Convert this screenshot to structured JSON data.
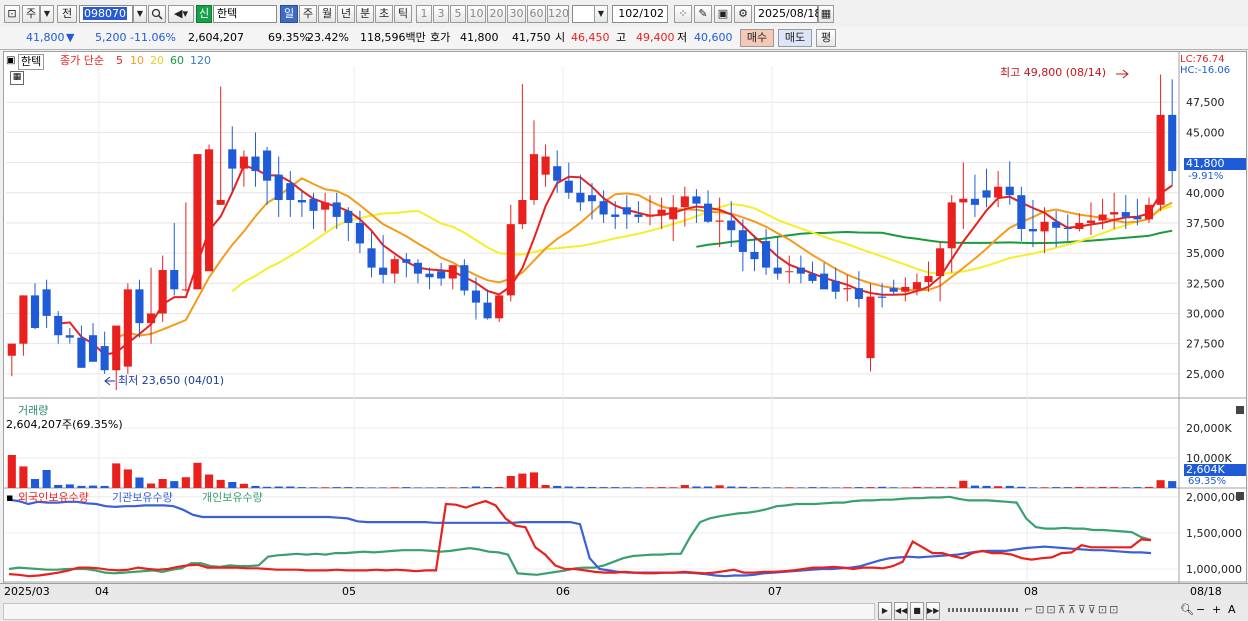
{
  "toolbar": {
    "market_type": "주",
    "prev_label": "전",
    "code": "098070",
    "new_badge": "신",
    "stock_name": "한텍",
    "periods": [
      "일",
      "주",
      "월",
      "년",
      "분",
      "초",
      "틱"
    ],
    "active_period": "일",
    "intervals": [
      "1",
      "3",
      "5",
      "10",
      "20",
      "30",
      "60",
      "120"
    ],
    "count": "102",
    "count_total": "/102",
    "date": "2025/08/18"
  },
  "quote": {
    "price": "41,800",
    "change_arrow": "▼",
    "change": "5,200",
    "change_pct": "-11.06%",
    "volume": "2,604,207",
    "vol_ratio": "69.35%",
    "turnover": "23.42%",
    "amount": "118,596백만",
    "hoga_label": "호가",
    "ask": "41,800",
    "bid": "41,750",
    "open_label": "시",
    "open": "46,450",
    "high_label": "고",
    "high": "49,400",
    "low_label": "저",
    "low": "40,600",
    "buy_label": "매수",
    "sell_label": "매도",
    "eval_label": "평"
  },
  "price_panel": {
    "name_tag": "한텍",
    "ma_label": "종가 단순",
    "ma_periods": [
      "5",
      "10",
      "20",
      "60",
      "120"
    ],
    "lc": "LC:76.74",
    "hc": "HC:-16.06",
    "high_note": "최고 49,800 (08/14)",
    "low_note": "최저 23,650 (04/01)",
    "cur_price": "41,800",
    "cur_pct": "-9.91%",
    "y_ticks": [
      "47,500",
      "45,000",
      "42,500",
      "40,000",
      "37,500",
      "35,000",
      "32,500",
      "30,000",
      "27,500",
      "25,000"
    ]
  },
  "volume_panel": {
    "title": "거래량",
    "current": "2,604,207주(69.35%)",
    "y_ticks": [
      "20,000K",
      "10,000K"
    ],
    "cur_value": "2,604K",
    "cur_pct": "69.35%"
  },
  "holding_panel": {
    "legend": [
      "외국인보유수량",
      "기관보유수량",
      "개인보유수량"
    ],
    "y_ticks": [
      "2,000,000",
      "1,500,000",
      "1,000,000"
    ]
  },
  "x_axis": {
    "labels": [
      "2025/03",
      "04",
      "05",
      "06",
      "07",
      "08"
    ],
    "end_label": "08/18"
  },
  "colors": {
    "up": "#e8211f",
    "down": "#1f5bd6",
    "ma5": "#e8211f",
    "ma10": "#f59b1c",
    "ma20": "#f5ee2a",
    "ma60": "#1a9a3a",
    "foreign": "#e8211f",
    "institution": "#3a60d8",
    "individual": "#3aa070"
  },
  "chart_data": {
    "type": "candlestick",
    "title": "한텍",
    "open": [
      26500,
      27500,
      31500,
      32000,
      29800,
      28200,
      28000,
      28200,
      27300,
      25300,
      25600,
      32000,
      29200,
      30000,
      33600,
      32000,
      32000,
      33500,
      39000,
      43600,
      42000,
      43000,
      43500,
      41500,
      40800,
      39400,
      39500,
      38600,
      39200,
      38500,
      37500,
      35400,
      33800,
      33300,
      34500,
      34200,
      33300,
      33500,
      32900,
      34000,
      31900,
      30900,
      29600,
      31500,
      37400,
      39400,
      41500,
      42200,
      41000,
      40000,
      39800,
      39300,
      38200,
      38800,
      38200,
      38100,
      38100,
      37800,
      38800,
      39700,
      39100,
      37600,
      37700,
      36900,
      35100,
      36000,
      33800,
      33500,
      33800,
      33300,
      33300,
      32700,
      32000,
      32100,
      26300,
      31400,
      32100,
      31800,
      32000,
      32600,
      33100,
      35400,
      39200,
      39500,
      40200,
      39600,
      40500,
      39800,
      37000,
      36800,
      37600,
      37100,
      37000,
      37500,
      37700,
      38200,
      38400,
      38000,
      37800,
      39000,
      46450
    ],
    "high": [
      27500,
      31500,
      32500,
      32800,
      30200,
      28800,
      29000,
      29200,
      28500,
      27200,
      32500,
      32800,
      33800,
      34800,
      37500,
      39200,
      43200,
      44000,
      48800,
      45500,
      43500,
      45000,
      43800,
      43000,
      41800,
      40200,
      40000,
      40000,
      40000,
      38800,
      38500,
      36800,
      36500,
      34800,
      35000,
      34500,
      33800,
      34200,
      34000,
      34500,
      33000,
      32000,
      31000,
      39000,
      49000,
      46000,
      44000,
      43500,
      42500,
      41500,
      40800,
      40200,
      39300,
      39800,
      39300,
      39800,
      39600,
      39800,
      40500,
      40300,
      40200,
      39600,
      39300,
      37800,
      36500,
      37000,
      36300,
      34800,
      34800,
      34300,
      34200,
      33800,
      33200,
      33500,
      32500,
      32500,
      32800,
      33000,
      33300,
      34300,
      36000,
      39800,
      42500,
      41500,
      42000,
      41800,
      42600,
      40500,
      39400,
      38800,
      38500,
      38200,
      38300,
      39200,
      39500,
      40000,
      39800,
      39500,
      39600,
      49800,
      49400
    ],
    "low": [
      24800,
      26500,
      28700,
      28800,
      27500,
      27500,
      25500,
      26000,
      25000,
      23650,
      25000,
      28000,
      27500,
      29300,
      31500,
      31800,
      32000,
      34500,
      39000,
      40000,
      40500,
      40500,
      39000,
      38000,
      38000,
      38000,
      37000,
      36800,
      37000,
      36000,
      35000,
      33000,
      32500,
      32500,
      33000,
      32500,
      32000,
      32300,
      32000,
      31500,
      29500,
      29500,
      29300,
      31000,
      37000,
      39000,
      40500,
      40000,
      39500,
      38500,
      37800,
      37500,
      37000,
      37000,
      37500,
      37300,
      37000,
      36000,
      37200,
      37500,
      37500,
      35500,
      35500,
      33500,
      33500,
      33200,
      32800,
      32500,
      32500,
      32500,
      32000,
      31200,
      31000,
      30500,
      25200,
      30500,
      31500,
      31000,
      31500,
      31800,
      31000,
      33400,
      37000,
      38000,
      38800,
      38800,
      39000,
      36000,
      35500,
      35000,
      35500,
      36000,
      36800,
      36500,
      37000,
      37000,
      37000,
      37300,
      37500,
      38500,
      40600
    ],
    "close": [
      27500,
      31500,
      28800,
      29800,
      28200,
      28000,
      25500,
      26000,
      25300,
      29000,
      32000,
      29200,
      30000,
      33600,
      32000,
      32000,
      43200,
      43600,
      39400,
      42000,
      43000,
      41800,
      41000,
      39400,
      39400,
      39200,
      38500,
      39200,
      38000,
      37500,
      35800,
      33800,
      33200,
      34500,
      34200,
      33300,
      33000,
      32900,
      34000,
      31900,
      30900,
      29600,
      31500,
      37400,
      39400,
      43200,
      43000,
      41000,
      40000,
      39200,
      39300,
      38200,
      38000,
      38200,
      38000,
      38100,
      38600,
      38800,
      39700,
      39100,
      37600,
      37700,
      36900,
      35100,
      34500,
      33800,
      33300,
      33500,
      33300,
      32700,
      32000,
      31800,
      32100,
      31200,
      31400,
      31300,
      31800,
      32200,
      32600,
      33100,
      35400,
      39200,
      39500,
      39000,
      39600,
      40500,
      39800,
      37000,
      36800,
      37600,
      37100,
      37000,
      37500,
      37700,
      38200,
      38400,
      38000,
      37800,
      39000,
      46450,
      41800
    ],
    "ylim": [
      23000,
      50500
    ],
    "volume_k": [
      11000,
      7200,
      3000,
      6000,
      1000,
      1200,
      700,
      800,
      700,
      8200,
      6200,
      3500,
      1500,
      3000,
      2300,
      3600,
      8400,
      4500,
      2700,
      2000,
      1400,
      700,
      400,
      500,
      500,
      300,
      250,
      250,
      300,
      300,
      250,
      200,
      200,
      250,
      300,
      200,
      200,
      250,
      200,
      300,
      500,
      350,
      350,
      4000,
      4800,
      5200,
      1000,
      700,
      500,
      400,
      350,
      300,
      300,
      250,
      250,
      250,
      300,
      250,
      1000,
      500,
      500,
      900,
      500,
      400,
      300,
      250,
      200,
      250,
      200,
      300,
      250,
      200,
      250,
      300,
      300,
      400,
      250,
      200,
      350,
      250,
      300,
      300,
      2400,
      800,
      700,
      600,
      700,
      400,
      250,
      250,
      300,
      300,
      350,
      250,
      350,
      300,
      250,
      300,
      350,
      2604,
      2300
    ],
    "volume_ylim": [
      0,
      28000
    ],
    "holdings": {
      "foreign": [
        930000,
        920000,
        900000,
        910000,
        930000,
        950000,
        980000,
        1020000,
        1020000,
        1010000,
        990000,
        980000,
        990000,
        1020000,
        1000000,
        990000,
        1000000,
        1030000,
        1050000,
        1060000,
        1020000,
        1020000,
        1020000,
        1020000,
        1010000,
        1010000,
        1000000,
        990000,
        990000,
        990000,
        980000,
        980000,
        980000,
        990000,
        980000,
        980000,
        980000,
        990000,
        980000,
        990000,
        980000,
        970000,
        980000,
        980000,
        1900000,
        1890000,
        1850000,
        1900000,
        1940000,
        1880000,
        1700000,
        1600000,
        1580000,
        1300000,
        1200000,
        1050000,
        1000000,
        1000000,
        980000,
        960000,
        950000,
        950000,
        960000,
        950000,
        940000,
        940000,
        950000,
        950000,
        960000,
        950000,
        940000,
        950000,
        970000,
        990000,
        950000,
        950000,
        960000,
        960000,
        970000,
        980000,
        1000000,
        1020000,
        1020000,
        1030000,
        1020000,
        1000000,
        1020000,
        1020000,
        1010000,
        1040000,
        1100000,
        1380000,
        1300000,
        1220000,
        1220000,
        1180000,
        1150000,
        1220000,
        1250000,
        1220000,
        1220000,
        1200000,
        1150000,
        1130000,
        1150000,
        1160000,
        1220000,
        1230000,
        1330000,
        1300000,
        1300000,
        1300000,
        1300000,
        1300000,
        1410000,
        1400000
      ],
      "institution": [
        1960000,
        1940000,
        1900000,
        1930000,
        1920000,
        1920000,
        1930000,
        1930000,
        1910000,
        1900000,
        1870000,
        1860000,
        1870000,
        1870000,
        1880000,
        1880000,
        1880000,
        1870000,
        1820000,
        1750000,
        1720000,
        1720000,
        1720000,
        1720000,
        1720000,
        1720000,
        1720000,
        1720000,
        1720000,
        1720000,
        1720000,
        1720000,
        1720000,
        1720000,
        1710000,
        1700000,
        1660000,
        1650000,
        1650000,
        1650000,
        1650000,
        1650000,
        1650000,
        1650000,
        1640000,
        1640000,
        1640000,
        1640000,
        1640000,
        1640000,
        1640000,
        1640000,
        1640000,
        1650000,
        1650000,
        1650000,
        1650000,
        1650000,
        1650000,
        1620000,
        1150000,
        1000000,
        980000,
        960000,
        950000,
        950000,
        950000,
        950000,
        950000,
        950000,
        950000,
        940000,
        930000,
        910000,
        900000,
        910000,
        910000,
        920000,
        940000,
        950000,
        960000,
        970000,
        980000,
        990000,
        1000000,
        1000000,
        1010000,
        1020000,
        1040000,
        1080000,
        1120000,
        1150000,
        1160000,
        1170000,
        1160000,
        1170000,
        1180000,
        1190000,
        1200000,
        1220000,
        1240000,
        1250000,
        1250000,
        1250000,
        1270000,
        1290000,
        1300000,
        1310000,
        1300000,
        1290000,
        1280000,
        1270000,
        1260000,
        1260000,
        1250000,
        1240000,
        1230000,
        1230000,
        1220000
      ],
      "individual": [
        1000000,
        1020000,
        1010000,
        1000000,
        990000,
        990000,
        1000000,
        1000000,
        1000000,
        980000,
        950000,
        940000,
        950000,
        960000,
        970000,
        980000,
        960000,
        990000,
        1010000,
        1080000,
        1080000,
        1040000,
        1030000,
        1050000,
        1040000,
        1040000,
        1050000,
        1170000,
        1190000,
        1200000,
        1210000,
        1200000,
        1210000,
        1200000,
        1220000,
        1220000,
        1230000,
        1240000,
        1230000,
        1240000,
        1250000,
        1260000,
        1260000,
        1260000,
        1250000,
        1240000,
        1250000,
        1270000,
        1290000,
        1270000,
        1240000,
        1230000,
        1200000,
        940000,
        930000,
        920000,
        940000,
        960000,
        980000,
        1010000,
        1020000,
        1020000,
        1050000,
        1100000,
        1150000,
        1180000,
        1190000,
        1200000,
        1200000,
        1210000,
        1210000,
        1450000,
        1650000,
        1700000,
        1730000,
        1750000,
        1770000,
        1780000,
        1800000,
        1830000,
        1870000,
        1880000,
        1900000,
        1900000,
        1900000,
        1910000,
        1920000,
        1920000,
        1940000,
        1950000,
        1950000,
        1960000,
        1960000,
        1970000,
        1980000,
        1980000,
        1990000,
        1990000,
        2000000,
        1970000,
        1950000,
        1950000,
        1950000,
        1940000,
        1930000,
        1920000,
        1700000,
        1580000,
        1560000,
        1560000,
        1570000,
        1560000,
        1560000,
        1540000,
        1540000,
        1530000,
        1520000,
        1510000,
        1440000,
        1400000
      ],
      "ylim": [
        820000,
        2080000
      ]
    }
  }
}
